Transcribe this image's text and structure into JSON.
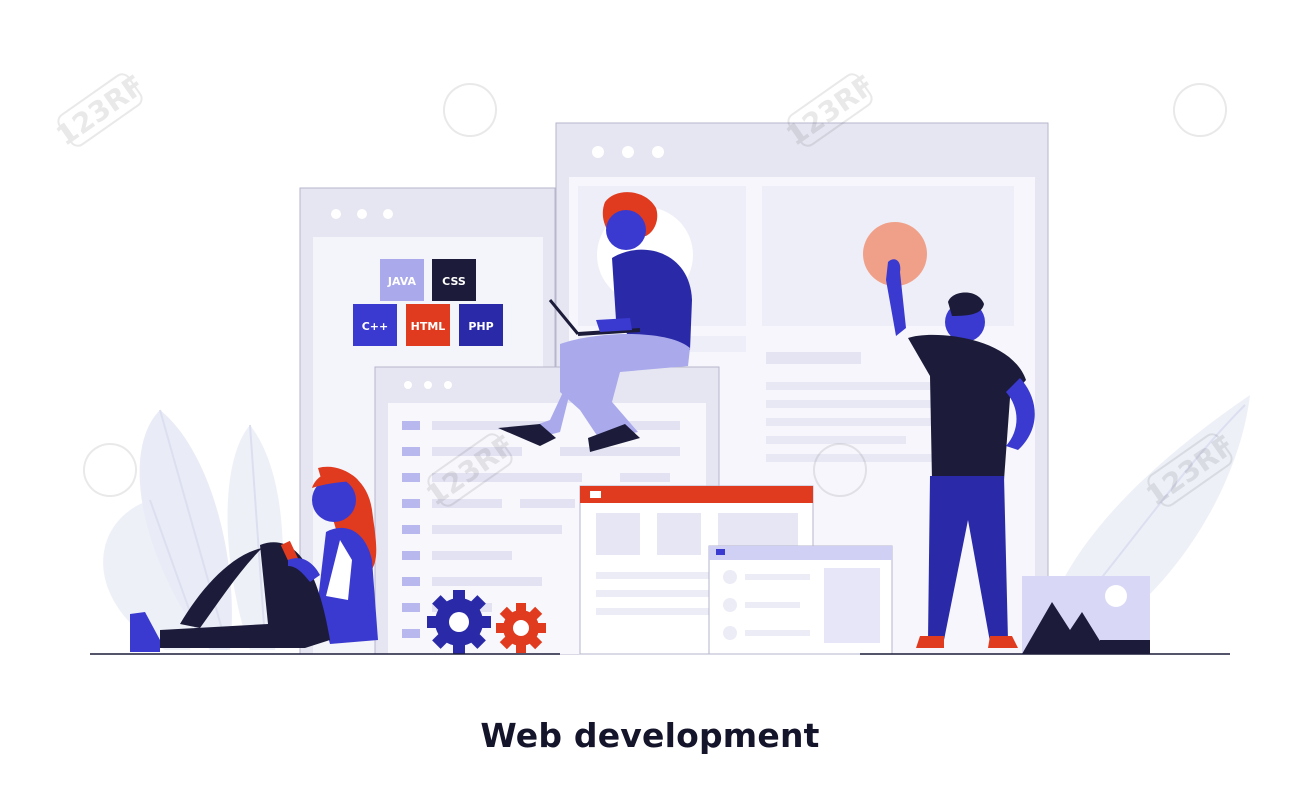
{
  "caption": "Web development",
  "code_tiles": [
    "JAVA",
    "CSS",
    "C++",
    "HTML",
    "PHP"
  ],
  "watermark": "123RF",
  "colors": {
    "accent_blue": "#3a3ad0",
    "navy": "#1c1c3a",
    "accent_red": "#e03b1e",
    "panel": "#f0f0fa",
    "frame": "#e6e6f2",
    "peach": "#f0a088"
  }
}
